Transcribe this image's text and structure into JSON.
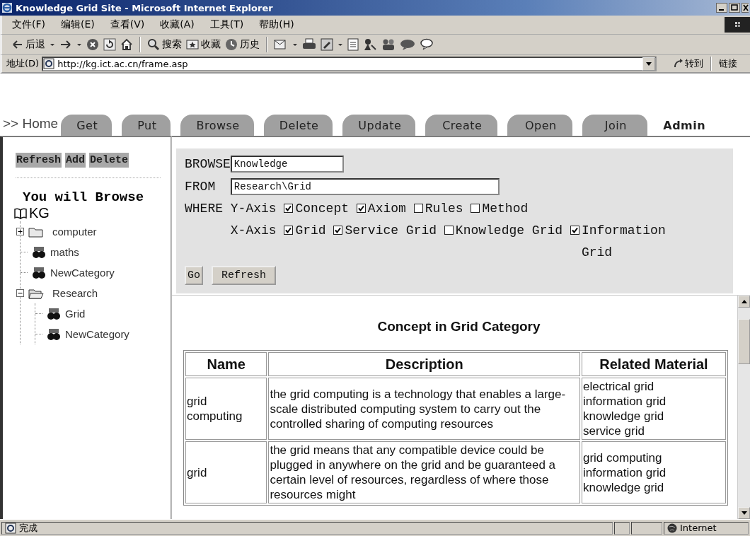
{
  "window": {
    "title": "Knowledge Grid Site - Microsoft Internet Explorer"
  },
  "menu": [
    "文件(F)",
    "编辑(E)",
    "查看(V)",
    "收藏(A)",
    "工具(T)",
    "帮助(H)"
  ],
  "toolbar": {
    "back": "后退",
    "search": "搜索",
    "favorites": "收藏",
    "history": "历史"
  },
  "address_bar": {
    "label": "地址(D)",
    "url": "http://kg.ict.ac.cn/frame.asp",
    "go": "转到",
    "links": "链接"
  },
  "nav": {
    "home": ">> Home",
    "tabs": [
      {
        "label": "Get",
        "selected": false
      },
      {
        "label": "Put",
        "selected": false
      },
      {
        "label": "Browse",
        "selected": false
      },
      {
        "label": "Delete",
        "selected": false
      },
      {
        "label": "Update",
        "selected": false
      },
      {
        "label": "Create",
        "selected": false
      },
      {
        "label": "Open",
        "selected": false
      },
      {
        "label": "Join",
        "selected": false
      },
      {
        "label": "Admin",
        "selected": true
      }
    ]
  },
  "sidebar": {
    "buttons": [
      "Refresh",
      "Add",
      "Delete"
    ],
    "heading": "You will Browse",
    "tree": {
      "label": "KG",
      "children": [
        {
          "kind": "folder",
          "label": "computer",
          "expanded": false
        },
        {
          "kind": "leaf",
          "label": "maths"
        },
        {
          "kind": "leaf",
          "label": "NewCategory"
        },
        {
          "kind": "folder",
          "label": "Research",
          "expanded": true,
          "children": [
            {
              "kind": "leaf",
              "label": "Grid"
            },
            {
              "kind": "leaf",
              "label": "NewCategory"
            }
          ]
        }
      ]
    }
  },
  "query": {
    "browse_label": "BROWSE",
    "browse_value": "Knowledge",
    "from_label": "FROM",
    "from_value": "Research\\Grid",
    "where_label": "WHERE",
    "axes": [
      {
        "label": "Y-Axis",
        "options": [
          {
            "label": "Concept",
            "checked": true
          },
          {
            "label": "Axiom",
            "checked": true
          },
          {
            "label": "Rules",
            "checked": false
          },
          {
            "label": "Method",
            "checked": false
          }
        ]
      },
      {
        "label": "X-Axis",
        "options": [
          {
            "label": "Grid",
            "checked": true
          },
          {
            "label": "Service Grid",
            "checked": true
          },
          {
            "label": "Knowledge Grid",
            "checked": false
          },
          {
            "label": "Information Grid",
            "checked": true
          }
        ]
      }
    ],
    "buttons": [
      "Go",
      "Refresh"
    ]
  },
  "results": {
    "title": "Concept in Grid Category",
    "table": {
      "columns": [
        "Name",
        "Description",
        "Related Material"
      ],
      "rows": [
        {
          "name": "grid computing",
          "description": "the grid computing is a technology that enables a large-scale distributed computing system to carry out the controlled sharing of computing resources",
          "related": [
            "electrical grid",
            "information grid",
            "knowledge grid",
            "service grid"
          ]
        },
        {
          "name": "grid",
          "description": "the grid means that any compatible device could be plugged in anywhere on the grid and be guaranteed a certain level of resources, regardless of where those resources might",
          "related": [
            "grid computing",
            "information grid",
            "knowledge grid"
          ]
        }
      ]
    }
  },
  "status_bar": {
    "text": "完成",
    "zone": "Internet"
  }
}
